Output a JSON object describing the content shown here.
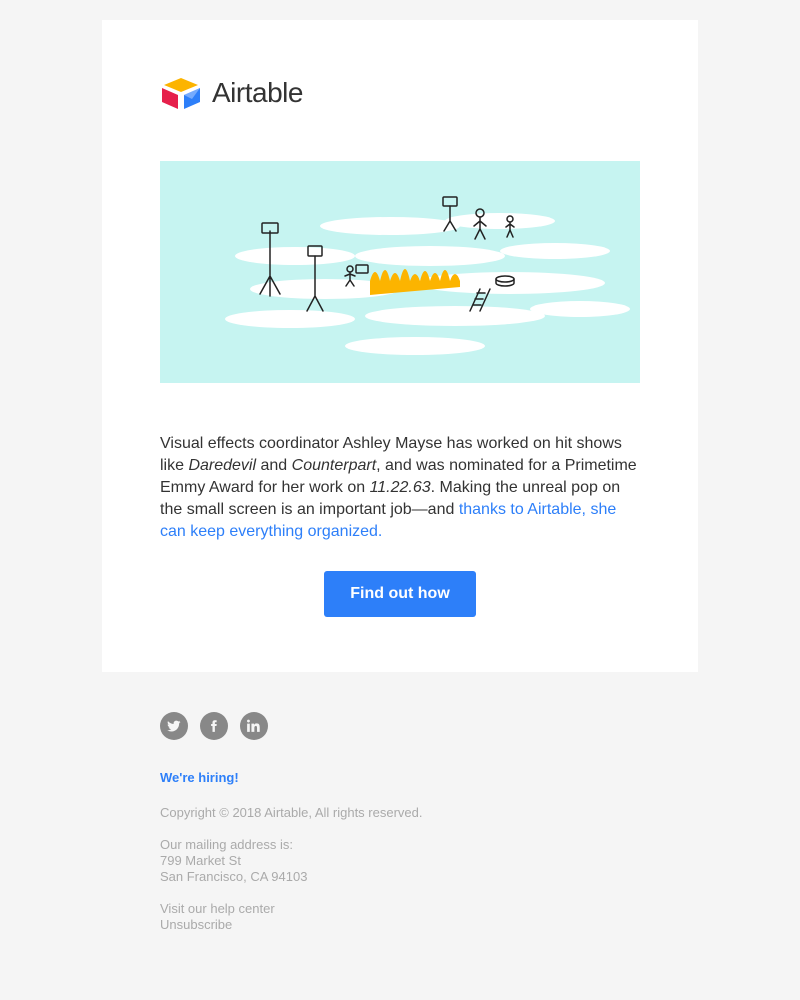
{
  "logo": {
    "wordmark": "Airtable"
  },
  "body": {
    "t1": "Visual effects coordinator Ashley Mayse has worked on hit shows like ",
    "em1": "Daredevil",
    "t2": " and ",
    "em2": "Counterpart",
    "t3": ", and was nominated for a Primetime Emmy Award for her work on ",
    "em3": "11.22.63",
    "t4": ". Making the unreal pop on the small screen is an important job—and ",
    "link": "thanks to Airtable, she can keep everything organized.",
    "cta": "Find out how"
  },
  "footer": {
    "hiring": "We're hiring!",
    "copyright": "Copyright © 2018 Airtable, All rights reserved.",
    "address_label": "Our mailing address is:",
    "address_line1": "799 Market St",
    "address_line2": "San Francisco, CA 94103",
    "help": "Visit our help center",
    "unsubscribe": "Unsubscribe"
  }
}
